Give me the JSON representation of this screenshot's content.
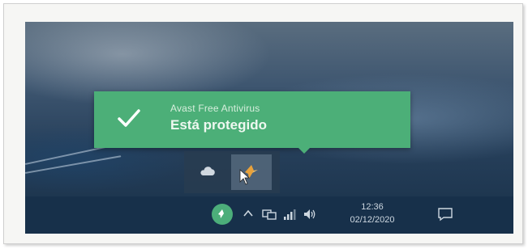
{
  "toast": {
    "title": "Avast Free Antivirus",
    "message": "Está protegido",
    "icon": "check-icon",
    "background_color": "#4caf78"
  },
  "tray_flyout": {
    "icons": [
      "cloud-drive-icon",
      "avast-flyout-icon"
    ]
  },
  "taskbar": {
    "tray_icons": [
      "avast-icon",
      "chevron-up-icon",
      "network-icon",
      "signal-icon",
      "volume-icon",
      "notification-icon"
    ],
    "clock": {
      "time": "12:36",
      "date": "02/12/2020"
    },
    "background_color": "#17304a"
  }
}
